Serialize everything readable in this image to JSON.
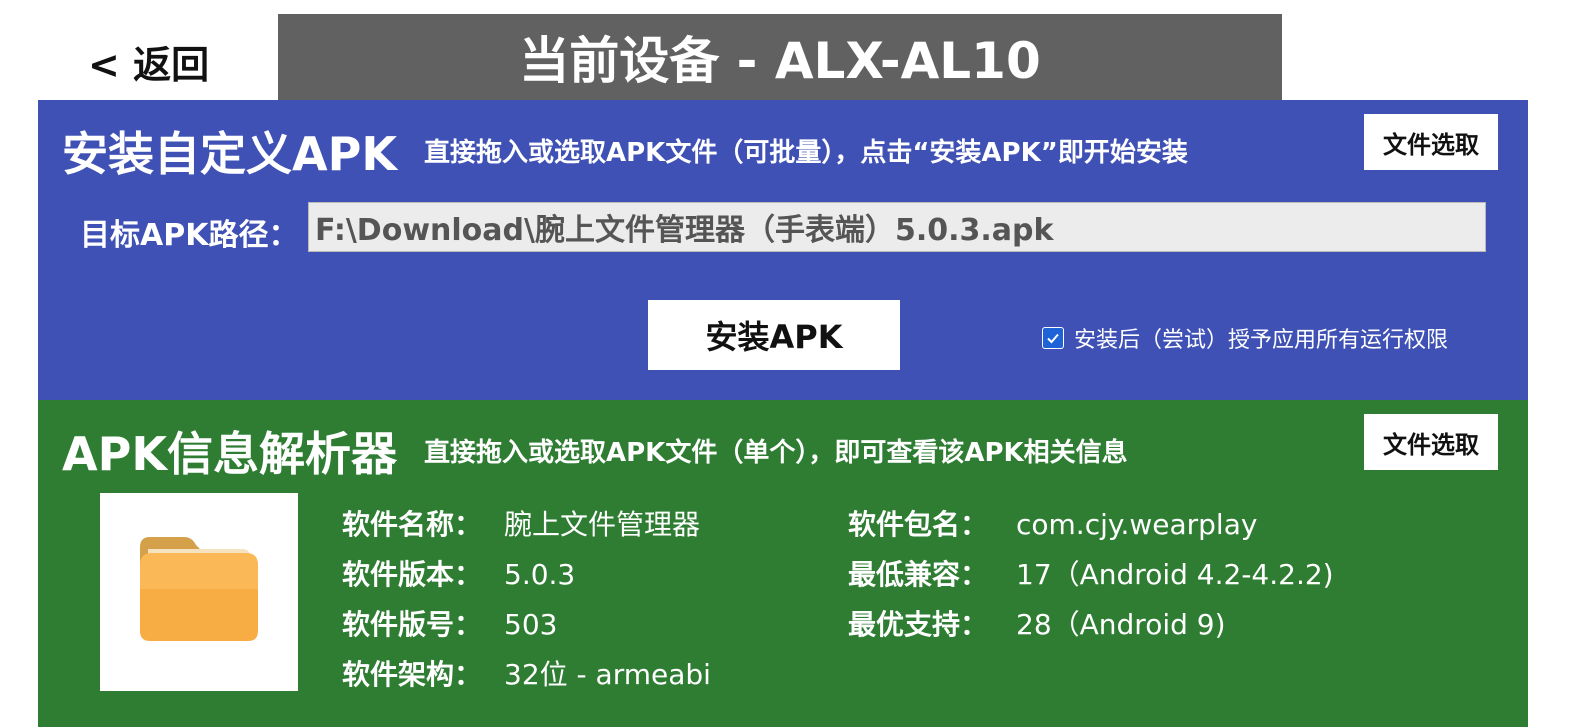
{
  "header": {
    "back_label": "< 返回",
    "title": "当前设备 - ALX-AL10"
  },
  "install": {
    "heading": "安装自定义APK",
    "description": "直接拖入或选取APK文件（可批量），点击“安装APK”即开始安装",
    "file_select_label": "文件选取",
    "path_label": "目标APK路径：",
    "path_value": "F:\\Download\\腕上文件管理器（手表端）5.0.3.apk",
    "install_button_label": "安装APK",
    "grant_permissions_label": "安装后（尝试）授予应用所有运行权限",
    "grant_permissions_checked": true
  },
  "parser": {
    "heading": "APK信息解析器",
    "description": "直接拖入或选取APK文件（单个），即可查看该APK相关信息",
    "file_select_label": "文件选取",
    "icon": "folder-icon",
    "left_fields": [
      {
        "key": "软件名称：",
        "value": "腕上文件管理器"
      },
      {
        "key": "软件版本：",
        "value": "5.0.3"
      },
      {
        "key": "软件版号：",
        "value": "503"
      },
      {
        "key": "软件架构：",
        "value": "32位 - armeabi"
      }
    ],
    "right_fields": [
      {
        "key": "软件包名：",
        "value": "com.cjy.wearplay"
      },
      {
        "key": "最低兼容：",
        "value": "17（Android 4.2-4.2.2)"
      },
      {
        "key": "最优支持：",
        "value": "28（Android 9)"
      }
    ]
  },
  "colors": {
    "install_panel": "#3f51b5",
    "parser_panel": "#2e7d32",
    "title_bar": "#616161"
  }
}
